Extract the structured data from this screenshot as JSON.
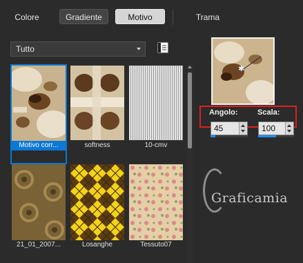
{
  "tabs": [
    {
      "label": "Colore"
    },
    {
      "label": "Gradiente"
    },
    {
      "label": "Motivo"
    },
    {
      "label": "Trama"
    }
  ],
  "category": {
    "selected": "Tutto"
  },
  "thumbnails": [
    {
      "label": "Motivo corr..."
    },
    {
      "label": "softness"
    },
    {
      "label": "10-cmv"
    },
    {
      "label": "21_01_2007..."
    },
    {
      "label": "Losanghe"
    },
    {
      "label": "Tessuto07"
    }
  ],
  "settings": {
    "angle_label": "Angolo:",
    "angle_value": "45",
    "scale_label": "Scala:",
    "scale_value": "100",
    "angle_slider_fraction": 0.125,
    "scale_slider_fraction": 0.5
  },
  "watermark": "Graficamia",
  "colors": {
    "accent": "#0a78d4",
    "highlight_box": "#e01e1e"
  }
}
